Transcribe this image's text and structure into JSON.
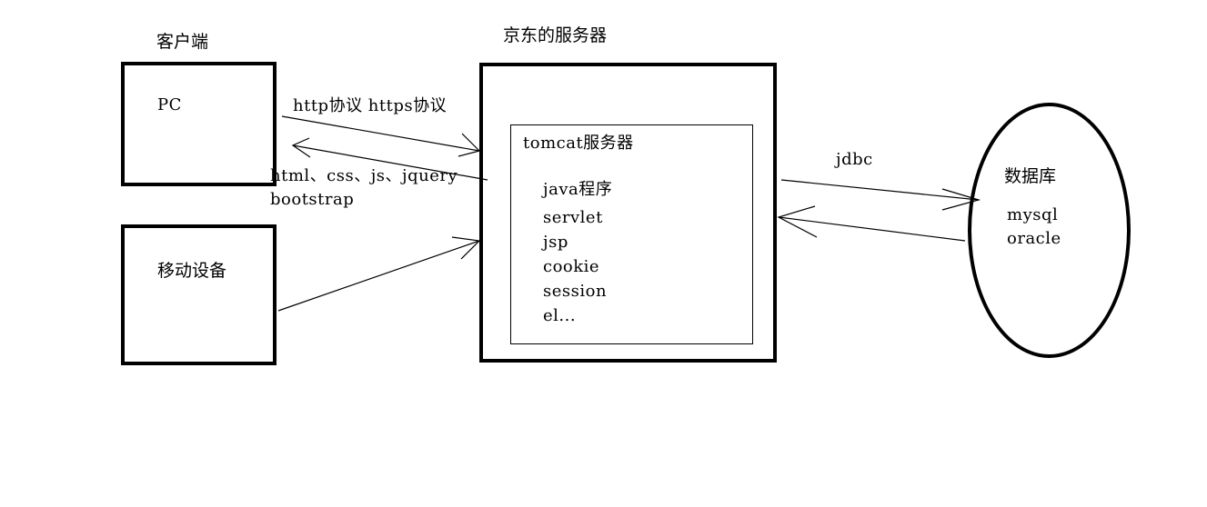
{
  "client": {
    "title": "客户端",
    "pc_label": "PC",
    "mobile_label": "移动设备"
  },
  "server": {
    "title": "京东的服务器",
    "tomcat": {
      "title": "tomcat服务器",
      "items": [
        "java程序",
        "servlet",
        "jsp",
        "cookie",
        "session",
        "el..."
      ]
    }
  },
  "protocol": {
    "request_label": "http协议 https协议",
    "response_label_line1": "html、css、js、jquery",
    "response_label_line2": "bootstrap"
  },
  "database": {
    "title": "数据库",
    "items": [
      "mysql",
      "oracle"
    ],
    "link_label": "jdbc"
  }
}
